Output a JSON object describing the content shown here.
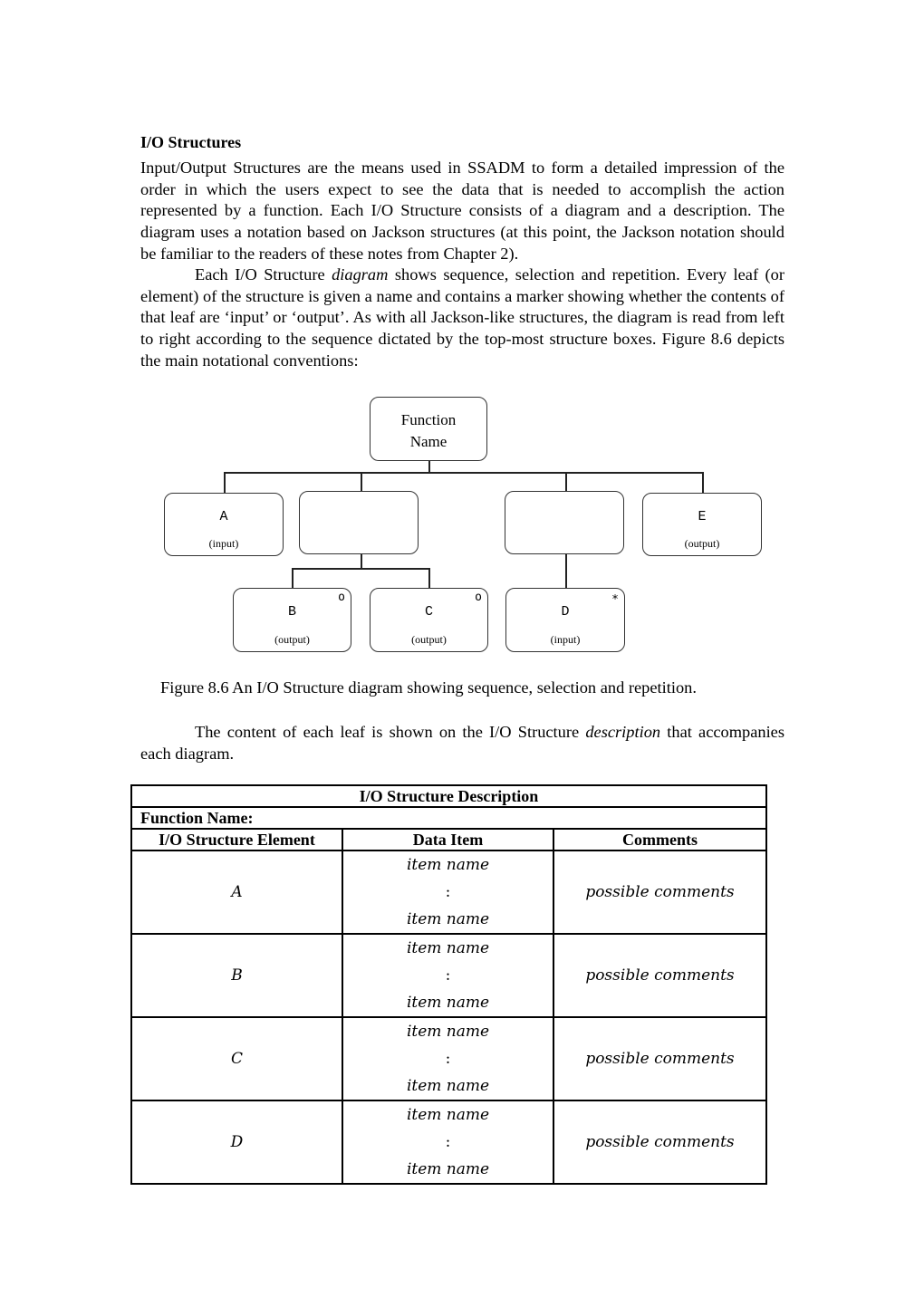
{
  "heading": "I/O Structures",
  "paragraph1": "Input/Output Structures are the means used in SSADM to form a detailed impression of the order in which the users expect to see the data that is needed to accomplish the action represented by a function. Each I/O Structure consists of a diagram and a description. The diagram uses a notation based on Jackson structures (at this point, the Jackson notation should be familiar to the readers of these notes from Chapter 2).",
  "paragraph2": {
    "before": "Each I/O Structure ",
    "emphasis": "diagram",
    "after": " shows sequence, selection and repetition. Every leaf (or element) of the structure is given a name and contains a marker showing whether the contents of that leaf are ‘input’ or ‘output’. As with all Jackson-like structures, the diagram is read from left to right according to the sequence dictated by the top-most structure boxes. Figure 8.6 depicts the main notational conventions:"
  },
  "diagram": {
    "root": {
      "line1": "Function",
      "line2": "Name"
    },
    "level1": [
      {
        "name": "A",
        "role": "(input)"
      },
      {
        "name": "",
        "role": ""
      },
      {
        "name": "",
        "role": ""
      },
      {
        "name": "E",
        "role": "(output)"
      }
    ],
    "level2": [
      {
        "name": "B",
        "role": "(output)",
        "marker": "o"
      },
      {
        "name": "C",
        "role": "(output)",
        "marker": "o"
      },
      {
        "name": "D",
        "role": "(input)",
        "marker": "∗"
      }
    ]
  },
  "caption": "Figure 8.6 An I/O Structure diagram showing sequence, selection and  repetition.",
  "paragraph3": {
    "before": "The content of each leaf is shown on the I/O Structure ",
    "emphasis": "description",
    "after": " that accompanies each diagram."
  },
  "table": {
    "title": "I/O Structure Description",
    "function_label": "Function Name:",
    "columns": [
      "I/O Structure Element",
      "Data Item",
      "Comments"
    ],
    "rows": [
      {
        "element": "A",
        "item_first": "item name",
        "separator": ":",
        "item_last": "item name",
        "comment": "possible comments"
      },
      {
        "element": "B",
        "item_first": "item name",
        "separator": ":",
        "item_last": "item name",
        "comment": "possible comments"
      },
      {
        "element": "C",
        "item_first": "item name",
        "separator": ":",
        "item_last": "item name",
        "comment": "possible comments"
      },
      {
        "element": "D",
        "item_first": "item name",
        "separator": ":",
        "item_last": "item name",
        "comment": "possible comments"
      }
    ]
  }
}
